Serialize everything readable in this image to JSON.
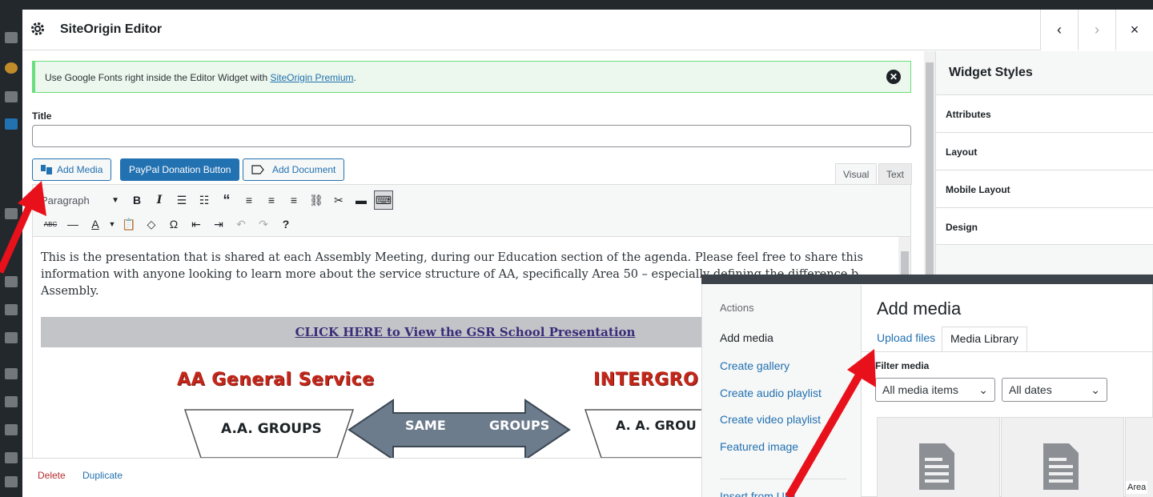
{
  "modal": {
    "title": "SiteOrigin Editor",
    "prev_icon": "‹",
    "next_icon": "›",
    "close_icon": "×"
  },
  "notice": {
    "text_before": "Use Google Fonts right inside the Editor Widget with ",
    "link": "SiteOrigin Premium",
    "text_after": "."
  },
  "form": {
    "title_label": "Title",
    "title_value": ""
  },
  "media_buttons": {
    "add_media": "Add Media",
    "paypal": "PayPal Donation Button",
    "add_document": "Add Document"
  },
  "editor_tabs": {
    "visual": "Visual",
    "text": "Text"
  },
  "toolbar": {
    "format_select": "Paragraph"
  },
  "editor": {
    "paragraph": "This is the presentation that is shared at each Assembly Meeting, during our Education section of the agenda. Please feel free to share this information with anyone looking to learn more about the service structure of AA, specifically Area 50 – especially defining the difference b",
    "paragraph_end": "Assembly.",
    "link_bar": "CLICK HERE to View the GSR School Presentation",
    "diagram_left_title": "AA General Service",
    "diagram_right_title": "INTERGRO",
    "diagram_box_left": "A.A. GROUPS",
    "diagram_arrow_left": "SAME",
    "diagram_arrow_right": "GROUPS",
    "diagram_box_right": "A. A. GROU"
  },
  "footer": {
    "delete": "Delete",
    "duplicate": "Duplicate"
  },
  "sidebar": {
    "title": "Widget Styles",
    "items": [
      {
        "label": "Attributes"
      },
      {
        "label": "Layout"
      },
      {
        "label": "Mobile Layout"
      },
      {
        "label": "Design"
      }
    ]
  },
  "media": {
    "menu_heading": "Actions",
    "menu_items": [
      {
        "label": "Add media"
      },
      {
        "label": "Create gallery"
      },
      {
        "label": "Create audio playlist"
      },
      {
        "label": "Create video playlist"
      },
      {
        "label": "Featured image"
      },
      {
        "label": "Insert from URL"
      }
    ],
    "title": "Add media",
    "tabs": {
      "upload": "Upload files",
      "library": "Media Library"
    },
    "filter_label": "Filter media",
    "filter_type": "All media items",
    "filter_date": "All dates",
    "thumb_label": "Area"
  },
  "colors": {
    "accent": "#2271b1",
    "arrow": "#e8111b",
    "notice_border": "#68de7c",
    "danger": "#b32d2e"
  }
}
